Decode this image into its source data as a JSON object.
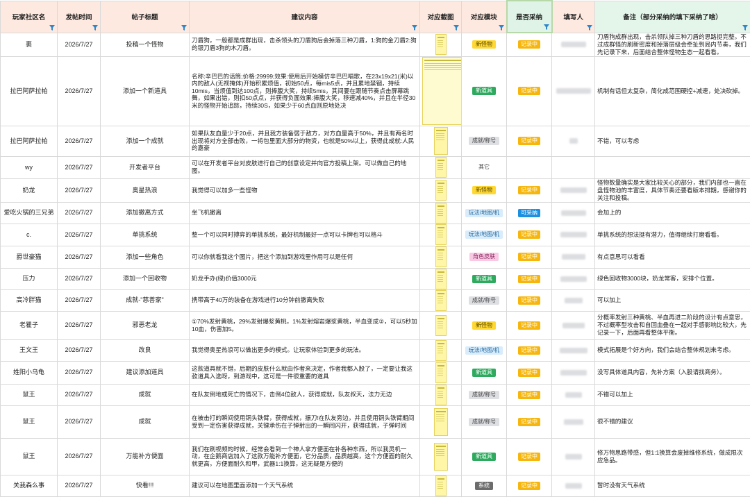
{
  "columns": [
    {
      "key": "name",
      "label": "玩家社区名"
    },
    {
      "key": "date",
      "label": "发帖时间"
    },
    {
      "key": "title",
      "label": "帖子标题"
    },
    {
      "key": "content",
      "label": "建议内容"
    },
    {
      "key": "shot",
      "label": "对应截图"
    },
    {
      "key": "module",
      "label": "对应模块"
    },
    {
      "key": "adopt",
      "label": "是否采纳"
    },
    {
      "key": "writer",
      "label": "填写人"
    },
    {
      "key": "note",
      "label": "备注（部分采纳的填下采纳了啥）"
    }
  ],
  "rows": [
    {
      "name": "裹",
      "date": "2026/7/27",
      "title": "投稿一个怪物",
      "content": "刀盾狗，一般都是成群出现，击杀领头的刀盾狗后会掉落三种刀盾，1:狗的金刀盾2:狗的银刀盾3狗的木刀盾。",
      "module": "新怪物",
      "adopt": "记录中",
      "note": "刀盾狗成群出现，击杀领队掉三种刀盾的思路挺完整。不过成群怪的刷新密度和掉落层级会牵扯到局内节奏，我们先记录下来，后面结合整体怪物生态一起看看。"
    },
    {
      "name": "拉巴阿萨拉帕",
      "date": "2026/7/27",
      "title": "添加一个新道具",
      "content": "名称:辛巴巴的话筒;价格:29999;效果:使用后开始模仿辛巴巴唱歌，在23x19x21(米)以内的敌人(无视掩体)开始积累烦值，初始50点，每mis5点，并且累地禁锢，持续10mis，当烦值到达100点，则捧腹大笑，持续5mis，其间要在跟随节奏点击屏幕跳舞，如果出错，则扣50点点，并获得负面效果:捧腹大笑，移速减40%，并且在半径30米的怪物开始追踪，持续30S，如果少于60点血则原地处决",
      "module": "新道具",
      "adopt": "记录中",
      "note": "机制有话但太复杂，简化成范围硬控+减速，处决砍掉。"
    },
    {
      "name": "拉巴阿萨拉帕",
      "date": "2026/7/27",
      "title": "添加一个成就",
      "content": "如果队友血量少于20点，并且我方装备弱于敌方，对方血量高于50%，并且有两名时出现将对方全部击败，一将包里面大部分的物资，也就是50%以上，获得此成就:人民的嘉豪",
      "module": "成就/称号",
      "adopt": "记录中",
      "note": "不错，可以考虑"
    },
    {
      "name": "wy",
      "date": "2026/7/27",
      "title": "开发者平台",
      "content": "可以在开发者平台对皮肤进行自己的创意设定并向官方投稿上架。可以做自己的地图。",
      "module": "其它",
      "adopt": "",
      "note": ""
    },
    {
      "name": "奶龙",
      "date": "2026/7/27",
      "title": "奥星热浪",
      "content": "我觉得可以加多一些怪物",
      "module": "新怪物",
      "adopt": "记录中",
      "note": "怪物数量确实是大家比较关心的部分，我们内部也一直在盘怪物池的丰富度，具体节奏还要看版本排期，感谢你的关注和投稿。"
    },
    {
      "name": "爱吃火锅的三兄弟",
      "date": "2026/7/27",
      "title": "添加撤离方式",
      "content": "坐飞机撤离",
      "module": "玩法/地图/机",
      "adopt": "可采纳",
      "note": "会加上的"
    },
    {
      "name": "c.",
      "date": "2026/7/27",
      "title": "单挑系统",
      "content": "整一个可以同时搏弈的单挑系统，最好机制最好一点可以卡牌也可以格斗",
      "module": "玩法/地图/机",
      "adopt": "记录中",
      "note": "单挑系统的想法挺有潜力，值得继续打磨看看。"
    },
    {
      "name": "爵世豪猫",
      "date": "2026/7/27",
      "title": "添加一些角色",
      "content": "可以你就看我这个图片，把这个添加到游戏里作用可以是任何",
      "module": "角色皮肤",
      "adopt": "记录中",
      "note": "有点意思可以看看"
    },
    {
      "name": "压力",
      "date": "2026/7/27",
      "title": "添加一个回收物",
      "content": "奶龙手办(绿)价值3000元",
      "module": "新道具",
      "adopt": "记录中",
      "note": "绿色回收物3000块，奶龙常客，安排个位置。"
    },
    {
      "name": "高冷胖猫",
      "date": "2026/7/27",
      "title": "成就-\"慈善家\"",
      "content": "携带高于40万的装备在游戏进行10分钟前撤离失败",
      "module": "成就/称号",
      "adopt": "记录中",
      "note": "可以加上"
    },
    {
      "name": "老瞿子",
      "date": "2026/7/27",
      "title": "邪恶老龙",
      "content": "①70%发射黄桃，29%发射爆浆黄桃，1%发射熔岩爆浆黄桃，半血变成②，可以5秒加10血，伤害加5。",
      "module": "新怪物",
      "adopt": "记录中",
      "note": "分概率发射三种黄桃、半血再进二阶段的设计有点意思，不过概率型攻击和自回血叠在一起对手感影响比较大，先记录一下，后面再看整体平衡。"
    },
    {
      "name": "王文王",
      "date": "2026/7/27",
      "title": "改良",
      "content": "我觉得奥星热浪可以做出更多的模式。让玩家体验到更多的玩法。",
      "module": "玩法/地图/机",
      "adopt": "记录中",
      "note": "模式拓展是个好方向，我们会结合整体规划来考虑。"
    },
    {
      "name": "姓阳小乌龟",
      "date": "2026/7/27",
      "title": "建议添加道具",
      "content": "这款道具就不错，后期的皮肤什么就由作者来决定，作者我都入股了，一定要让我这款道具入选呀，到游戏中，这可是一件很重要的道具",
      "module": "新道具",
      "adopt": "记录中",
      "note": "没写具体道具内容，先补方案（入股请找商务）。"
    },
    {
      "name": "鼠王",
      "date": "2026/7/27",
      "title": "成就",
      "content": "在队友倒地或死亡的情况下，击倒4位敌人，获得成就，队友叔天，法力无边",
      "module": "成就/称号",
      "adopt": "记录中",
      "note": "不错可以加上"
    },
    {
      "name": "鼠王",
      "date": "2026/7/27",
      "title": "成就",
      "content": "在被击打的瞬间使用铜头铁臂，获得成就，振刀!在队友旁边，并且使用铜头铁臂期间受到一定伤害获得成就，关键承伤在子弹射出的一瞬间闪开，获得成就，子弹时间",
      "module": "成就/称号",
      "adopt": "记录中",
      "note": "很不错的建议"
    },
    {
      "name": "鼠王",
      "date": "2026/7/27",
      "title": "万能补方便面",
      "content": "我们在刷视频的时候，经常会看到一个神人拿方便面在补各种东西，所以我灵机一动，在企鹅商店加入了这款万能补方便面，它分品质，品质越高，这个方便面的耐久就更高，方便面耐久和甲，武器1:1换算，这无疑是方便的",
      "module": "新道具",
      "adopt": "记录中",
      "note": "修万物思路带感，但1:1换算会废掉维修系统，做成限次应急品。"
    },
    {
      "name": "关我森么事",
      "date": "2026/7/27",
      "title": "快看!!!",
      "content": "建议可以在地图里面添加一个天气系统",
      "module": "系统",
      "adopt": "记录中",
      "note": "暂时没有天气系统"
    }
  ],
  "colors": {
    "header_bg": "#fde9e0",
    "adopt_header_bg": "#dff3e6",
    "rec": "#f6b60e",
    "ok": "#1c8fe0"
  }
}
